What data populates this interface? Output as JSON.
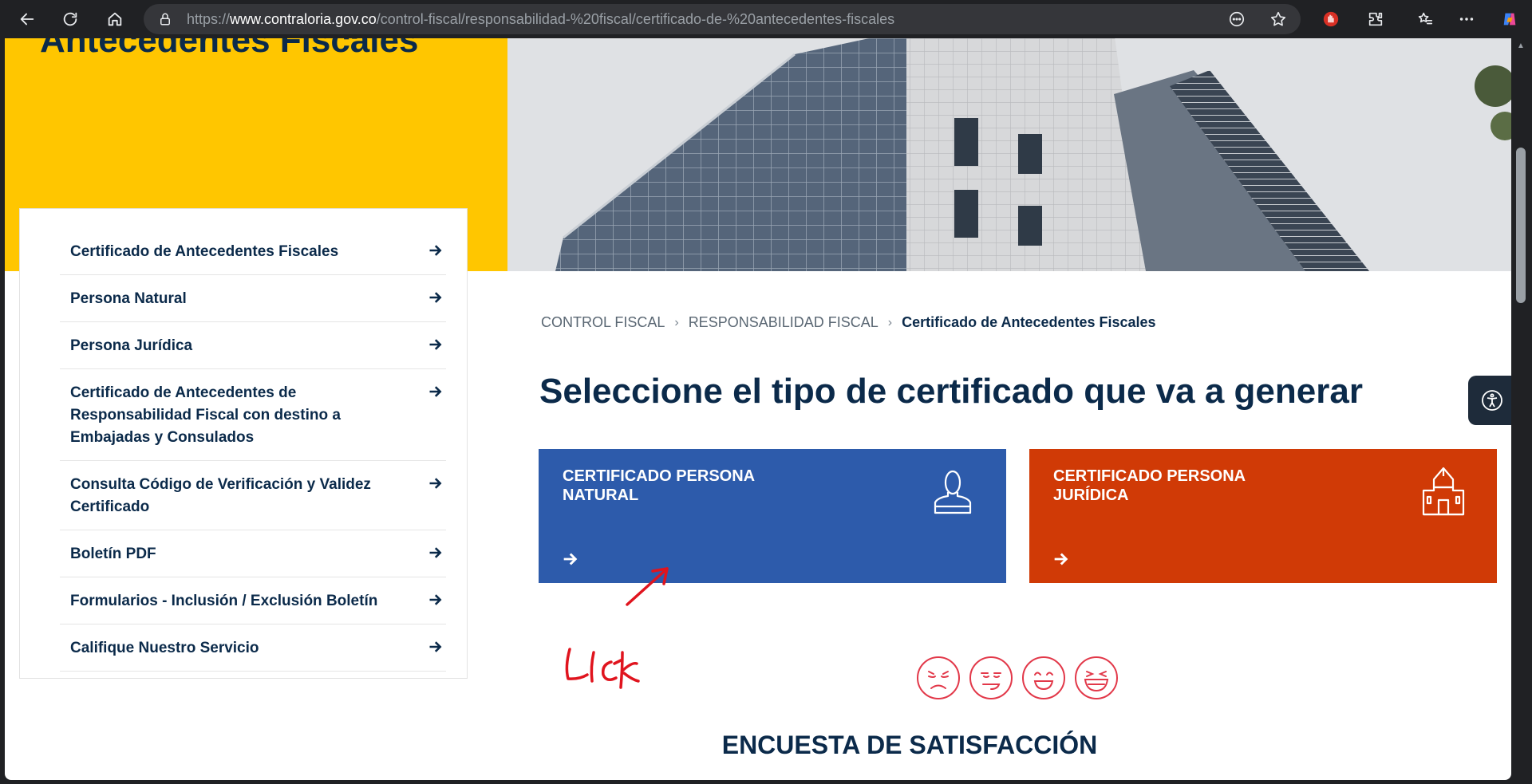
{
  "browser": {
    "url_prefix": "https://",
    "url_host": "www.contraloria.gov.co",
    "url_path": "/control-fiscal/responsabilidad-%20fiscal/certificado-de-%20antecedentes-fiscales"
  },
  "hero": {
    "title": "Antecedentes Fiscales"
  },
  "side_menu": {
    "items": [
      {
        "label": "Certificado de Antecedentes Fiscales"
      },
      {
        "label": "Persona Natural"
      },
      {
        "label": "Persona Jurídica"
      },
      {
        "label": "Certificado de Antecedentes de Responsabilidad Fiscal con destino a Embajadas y Consulados"
      },
      {
        "label": "Consulta Código de Verificación y Validez Certificado"
      },
      {
        "label": "Boletín PDF"
      },
      {
        "label": "Formularios - Inclusión / Exclusión Boletín"
      },
      {
        "label": "Califique Nuestro Servicio"
      }
    ]
  },
  "breadcrumb": {
    "items": [
      "CONTROL FISCAL",
      "RESPONSABILIDAD FISCAL"
    ],
    "current": "Certificado de Antecedentes Fiscales"
  },
  "main": {
    "heading": "Seleccione el tipo de certificado que va a generar",
    "cards": [
      {
        "title": "CERTIFICADO PERSONA NATURAL",
        "icon": "person-icon",
        "color": "#2d5bab"
      },
      {
        "title": "CERTIFICADO PERSONA JURÍDICA",
        "icon": "building-icon",
        "color": "#d03a06"
      }
    ]
  },
  "annotation": {
    "text": "Click",
    "color": "#e0141e"
  },
  "survey": {
    "title": "ENCUESTA DE SATISFACCIÓN",
    "faces": [
      "sad-face-icon",
      "neutral-face-icon",
      "happy-face-icon",
      "laughing-face-icon"
    ]
  },
  "colors": {
    "brand_yellow": "#ffc600",
    "navy": "#0b2a4a"
  }
}
